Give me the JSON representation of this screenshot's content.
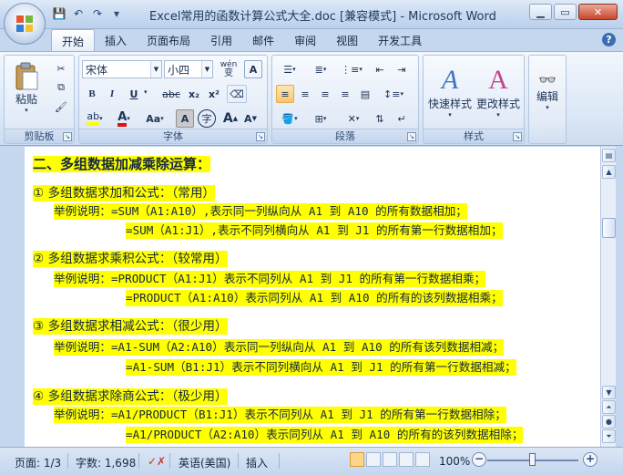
{
  "window": {
    "title": "Excel常用的函数计算公式大全.doc [兼容模式] - Microsoft Word",
    "minimize": "▁",
    "maximize": "▭",
    "close": "✕"
  },
  "qat": {
    "save": "💾",
    "undo": "↶",
    "redo": "↷",
    "more": "▾"
  },
  "tabs": [
    "开始",
    "插入",
    "页面布局",
    "引用",
    "邮件",
    "审阅",
    "视图",
    "开发工具"
  ],
  "help": "?",
  "ribbon": {
    "clipboard": {
      "paste": "粘贴",
      "label": "剪贴板"
    },
    "font": {
      "name": "宋体",
      "size": "小四",
      "label": "字体",
      "bold": "B",
      "italic": "I",
      "underline": "U",
      "strike": "abc",
      "subscript": "x₂",
      "superscript": "x²",
      "grow": "A",
      "shrink": "A",
      "change_case": "Aa",
      "char_shading": "A",
      "enclose": "字",
      "wen": "wén",
      "border_a": "A"
    },
    "paragraph": {
      "label": "段落"
    },
    "styles": {
      "quick": "快速样式",
      "change": "更改样式",
      "label": "样式"
    },
    "editing": {
      "label": "编辑"
    }
  },
  "document": {
    "lines": [
      {
        "text": "二、多组数据加减乘除运算：",
        "kind": "heading"
      },
      {
        "text": "① 多组数据求加和公式：（常用）",
        "kind": "item"
      },
      {
        "text": "举例说明：=SUM（A1:A10）,表示同一列纵向从 A1 到 A10 的所有数据相加；",
        "kind": "example"
      },
      {
        "text": "=SUM（A1:J1）,表示不同列横向从 A1 到 J1 的所有第一行数据相加；",
        "kind": "example2"
      },
      {
        "text": "② 多组数据求乘积公式：（较常用）",
        "kind": "item"
      },
      {
        "text": "举例说明：=PRODUCT（A1:J1）表示不同列从 A1 到 J1 的所有第一行数据相乘；",
        "kind": "example"
      },
      {
        "text": "=PRODUCT（A1:A10）表示同列从 A1 到 A10 的所有的该列数据相乘；",
        "kind": "example2"
      },
      {
        "text": "③ 多组数据求相减公式：（很少用）",
        "kind": "item"
      },
      {
        "text": "举例说明：=A1-SUM（A2:A10）表示同一列纵向从 A1 到 A10 的所有该列数据相减；",
        "kind": "example"
      },
      {
        "text": "=A1-SUM（B1:J1）表示不同列横向从 A1 到 J1 的所有第一行数据相减；",
        "kind": "example2"
      },
      {
        "text": "④ 多组数据求除商公式：（极少用）",
        "kind": "item"
      },
      {
        "text": "举例说明：=A1/PRODUCT（B1:J1）表示不同列从 A1 到 J1 的所有第一行数据相除；",
        "kind": "example"
      },
      {
        "text": "=A1/PRODUCT（A2:A10）表示同列从 A1 到 A10 的所有的该列数据相除；",
        "kind": "example2"
      }
    ]
  },
  "statusbar": {
    "page": "页面: 1/3",
    "words": "字数: 1,698",
    "language": "英语(美国)",
    "mode": "插入",
    "zoom": "100%",
    "zoom_minus": "−",
    "zoom_plus": "+"
  },
  "colors": {
    "highlight": "#ffff00",
    "ribbon": "#dbe7f6",
    "window": "#c5d7ee"
  }
}
